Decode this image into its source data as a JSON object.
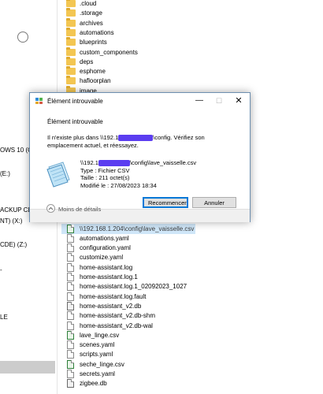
{
  "nav": {
    "items": [
      "OWS 10 (C:)",
      "(E:)",
      "ACKUP CLE (",
      "NT) (X:)",
      "CDE) (Z:)",
      "-",
      "LE"
    ]
  },
  "files": [
    {
      "name": ".cloud",
      "type": "folder"
    },
    {
      "name": ".storage",
      "type": "folder"
    },
    {
      "name": "archives",
      "type": "folder"
    },
    {
      "name": "automations",
      "type": "folder"
    },
    {
      "name": "blueprints",
      "type": "folder"
    },
    {
      "name": "custom_components",
      "type": "folder"
    },
    {
      "name": "deps",
      "type": "folder"
    },
    {
      "name": "esphome",
      "type": "folder"
    },
    {
      "name": "hafloorplan",
      "type": "folder"
    },
    {
      "name": "image",
      "type": "folder"
    },
    {
      "name": "\\\\192.168.1.204\\config\\lave_vaisselle.csv",
      "type": "csv",
      "selected": true
    },
    {
      "name": "automations.yaml",
      "type": "file"
    },
    {
      "name": "configuration.yaml",
      "type": "file"
    },
    {
      "name": "customize.yaml",
      "type": "file"
    },
    {
      "name": "home-assistant.log",
      "type": "file"
    },
    {
      "name": "home-assistant.log.1",
      "type": "file"
    },
    {
      "name": "home-assistant.log.1_02092023_1027",
      "type": "file"
    },
    {
      "name": "home-assistant.log.fault",
      "type": "file"
    },
    {
      "name": "home-assistant_v2.db",
      "type": "db"
    },
    {
      "name": "home-assistant_v2.db-shm",
      "type": "file"
    },
    {
      "name": "home-assistant_v2.db-wal",
      "type": "file"
    },
    {
      "name": "lave_linge.csv",
      "type": "csv"
    },
    {
      "name": "scenes.yaml",
      "type": "file"
    },
    {
      "name": "scripts.yaml",
      "type": "file"
    },
    {
      "name": "seche_linge.csv",
      "type": "csv"
    },
    {
      "name": "secrets.yaml",
      "type": "file"
    },
    {
      "name": "zigbee.db",
      "type": "db"
    }
  ],
  "dialog": {
    "title": "Élément introuvable",
    "heading": "Élément introuvable",
    "message_part1": "Il n'existe plus dans \\\\192.1",
    "message_part2": "\\config. Vérifiez son emplacement actuel, et réessayez.",
    "file_path_part1": "\\\\192.1",
    "file_path_part2": "\\config\\lave_vaisselle.csv",
    "type_line": "Type : Fichier CSV",
    "size_line": "Taille : 211 octet(s)",
    "modified_line": "Modifié le : 27/08/2023 18:34",
    "retry_label": "Recommencer",
    "cancel_label": "Annuler",
    "less_details_label": "Moins de détails",
    "close_glyph": "✕",
    "minimize_glyph": "—",
    "maximize_glyph": "☐"
  }
}
